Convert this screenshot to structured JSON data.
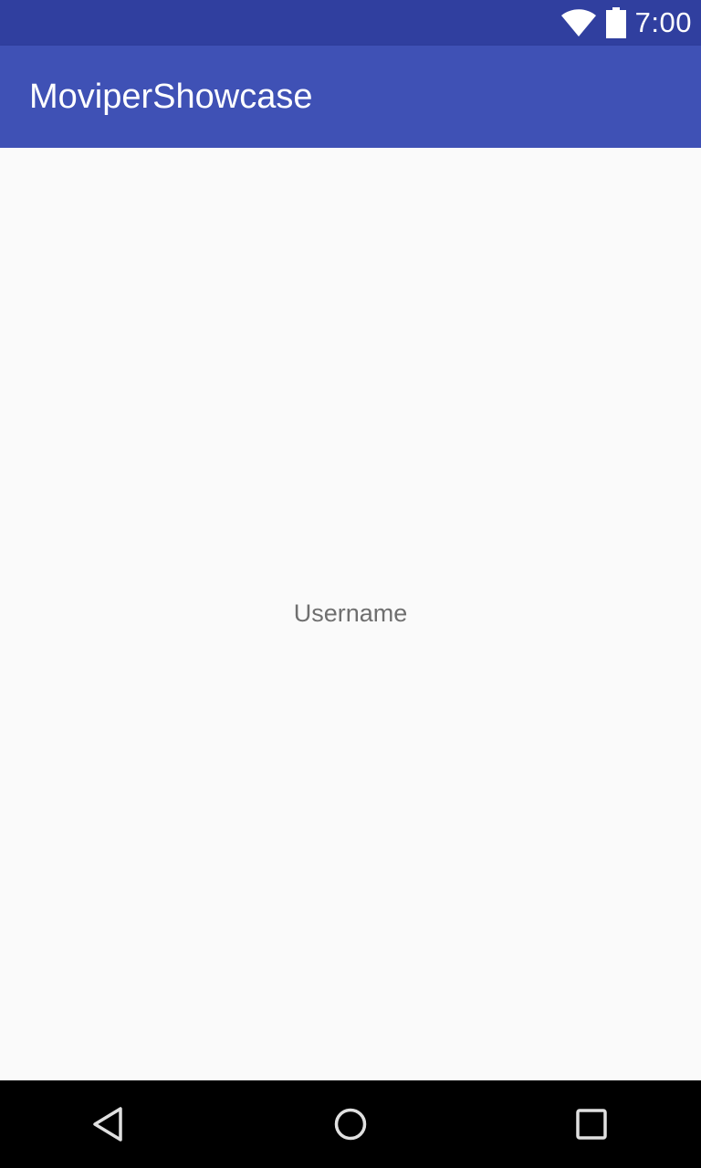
{
  "status_bar": {
    "time": "7:00",
    "icons": [
      "wifi-icon",
      "battery-icon"
    ],
    "background": "#303F9F"
  },
  "app_bar": {
    "title": "MoviperShowcase",
    "background": "#3F51B5"
  },
  "content": {
    "username_label": "Username",
    "background": "#FAFAFA"
  },
  "nav_bar": {
    "buttons": [
      "back-icon",
      "home-icon",
      "recents-icon"
    ],
    "background": "#000000"
  }
}
